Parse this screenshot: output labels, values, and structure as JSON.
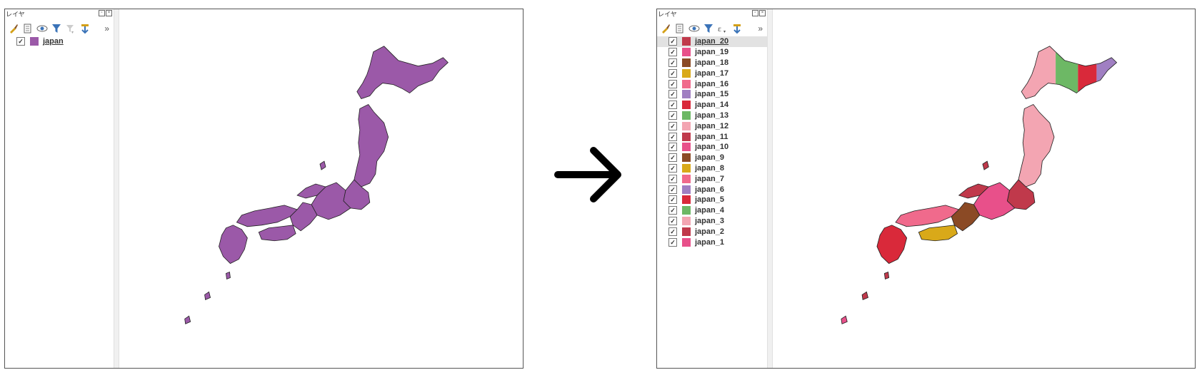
{
  "left": {
    "panel_title": "レイヤ",
    "layers": [
      {
        "name": "japan",
        "color": "#9b59a8",
        "checked": true
      }
    ],
    "map_fill": "#9b59a8"
  },
  "right": {
    "panel_title": "レイヤ",
    "layers": [
      {
        "name": "japan_20",
        "color": "#c0394b",
        "checked": true
      },
      {
        "name": "japan_19",
        "color": "#e8508a",
        "checked": true
      },
      {
        "name": "japan_18",
        "color": "#8b4a25",
        "checked": true
      },
      {
        "name": "japan_17",
        "color": "#d9a919",
        "checked": true
      },
      {
        "name": "japan_16",
        "color": "#f06a8c",
        "checked": true
      },
      {
        "name": "japan_15",
        "color": "#a07fc2",
        "checked": true
      },
      {
        "name": "japan_14",
        "color": "#d9293a",
        "checked": true
      },
      {
        "name": "japan_13",
        "color": "#6db865",
        "checked": true
      },
      {
        "name": "japan_12",
        "color": "#f3a5b2",
        "checked": true
      },
      {
        "name": "japan_11",
        "color": "#c0394b",
        "checked": true
      },
      {
        "name": "japan_10",
        "color": "#e8508a",
        "checked": true
      },
      {
        "name": "japan_9",
        "color": "#8b4a25",
        "checked": true
      },
      {
        "name": "japan_8",
        "color": "#d9a919",
        "checked": true
      },
      {
        "name": "japan_7",
        "color": "#f06a8c",
        "checked": true
      },
      {
        "name": "japan_6",
        "color": "#a07fc2",
        "checked": true
      },
      {
        "name": "japan_5",
        "color": "#d9293a",
        "checked": true
      },
      {
        "name": "japan_4",
        "color": "#6db865",
        "checked": true
      },
      {
        "name": "japan_3",
        "color": "#f3a5b2",
        "checked": true
      },
      {
        "name": "japan_2",
        "color": "#c0394b",
        "checked": true
      },
      {
        "name": "japan_1",
        "color": "#e8508a",
        "checked": true
      }
    ]
  },
  "toolbar_icons": [
    "paintbrush-icon",
    "add-group-icon",
    "eye-icon",
    "filter-icon",
    "expression-filter-icon",
    "expand-all-icon",
    "more-icon"
  ],
  "arrow_icon": "right-arrow-icon"
}
